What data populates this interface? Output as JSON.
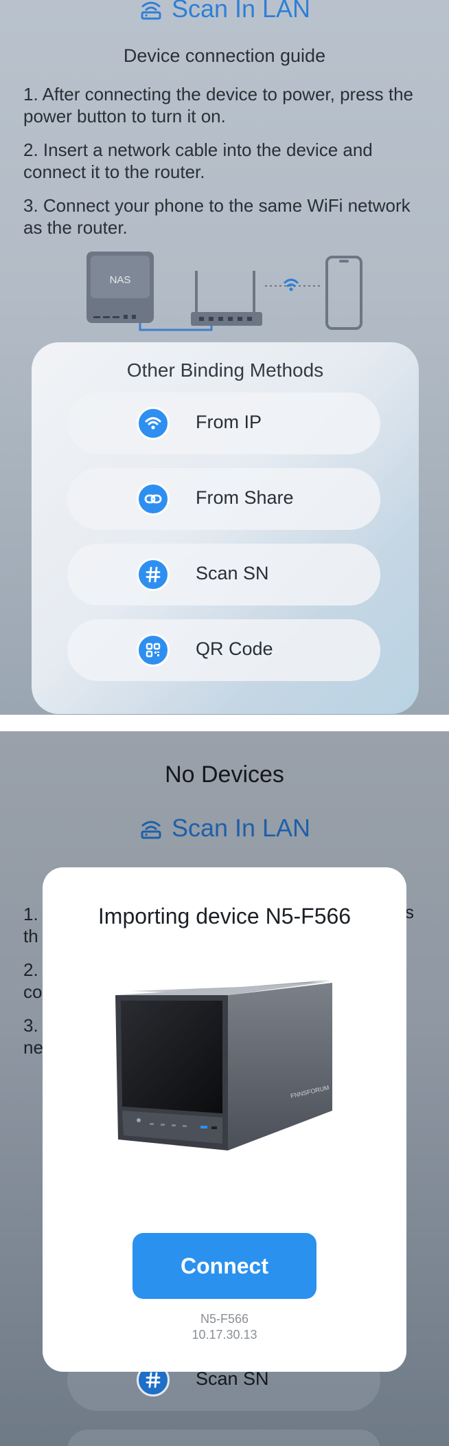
{
  "screen1": {
    "scan_label": "Scan In LAN",
    "guide_title": "Device connection guide",
    "steps": [
      "1. After connecting the device to power, press the power button to turn it on.",
      "2. Insert a network cable into the device and connect it to the router.",
      "3. Connect your phone to the same WiFi network as the router."
    ],
    "nas_label": "NAS",
    "sheet": {
      "title": "Other Binding Methods",
      "methods": [
        {
          "label": "From IP",
          "icon": "wifi-icon"
        },
        {
          "label": "From Share",
          "icon": "link-icon"
        },
        {
          "label": "Scan SN",
          "icon": "hash-icon"
        },
        {
          "label": "QR Code",
          "icon": "qr-code-icon"
        }
      ]
    }
  },
  "screen2": {
    "no_devices": "No Devices",
    "scan_label": "Scan In LAN",
    "step_fragments": [
      {
        "line1": "1.",
        "line2": "th"
      },
      {
        "line1": "2.",
        "line2": "co"
      },
      {
        "line1": "3.",
        "line2": "ne"
      }
    ],
    "tail_fragment": "s",
    "modal": {
      "title": "Importing device N5-F566",
      "connect_label": "Connect",
      "device_name": "N5-F566",
      "device_ip": "10.17.30.13",
      "brand_mark": "FNNSFORUM"
    },
    "method_behind": {
      "label": "Scan SN",
      "icon": "hash-icon"
    }
  },
  "colors": {
    "accent": "#2a91ef",
    "scan_blue": "#2f7fd6",
    "modal_bg": "#ffffff"
  }
}
